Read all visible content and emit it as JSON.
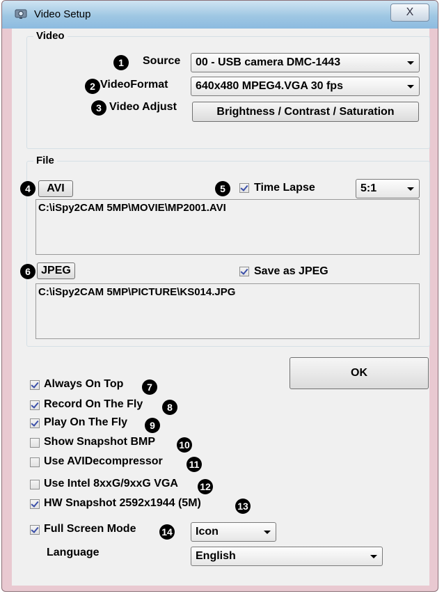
{
  "window": {
    "title": "Video Setup",
    "close_glyph": "X"
  },
  "video_group": {
    "label": "Video",
    "source": {
      "number": "1",
      "label": "Source",
      "value": "00 - USB camera DMC-1443"
    },
    "format": {
      "number": "2",
      "label": "VideoFormat",
      "value": "640x480 MPEG4.VGA 30 fps"
    },
    "adjust": {
      "number": "3",
      "label": "Video Adjust",
      "button": "Brightness / Contrast / Saturation"
    }
  },
  "file_group": {
    "label": "File",
    "avi": {
      "number": "4",
      "button": "AVI",
      "path": "C:\\iSpy2CAM 5MP\\MOVIE\\MP2001.AVI"
    },
    "time_lapse": {
      "number": "5",
      "label": "Time Lapse",
      "checked": true,
      "value": "5:1"
    },
    "jpeg": {
      "number": "6",
      "button": "JPEG",
      "path": "C:\\iSpy2CAM 5MP\\PICTURE\\KS014.JPG"
    },
    "save_jpeg": {
      "label": "Save as JPEG",
      "checked": true
    }
  },
  "ok_button": "OK",
  "options": [
    {
      "label": "Always On Top",
      "number": "7",
      "checked": true
    },
    {
      "label": "Record On The Fly",
      "number": "8",
      "checked": true
    },
    {
      "label": "Play On The Fly",
      "number": "9",
      "checked": true
    },
    {
      "label": "Show Snapshot BMP",
      "number": "10",
      "checked": false
    },
    {
      "label": "Use AVIDecompressor",
      "number": "11",
      "checked": false
    },
    {
      "label": "Use Intel 8xxG/9xxG VGA",
      "number": "12",
      "checked": false
    },
    {
      "label": "HW Snapshot 2592x1944 (5M)",
      "number": "13",
      "checked": true
    },
    {
      "label": "Full Screen Mode",
      "number": "14",
      "checked": true
    }
  ],
  "full_screen_select": "Icon",
  "language": {
    "label": "Language",
    "value": "English"
  }
}
